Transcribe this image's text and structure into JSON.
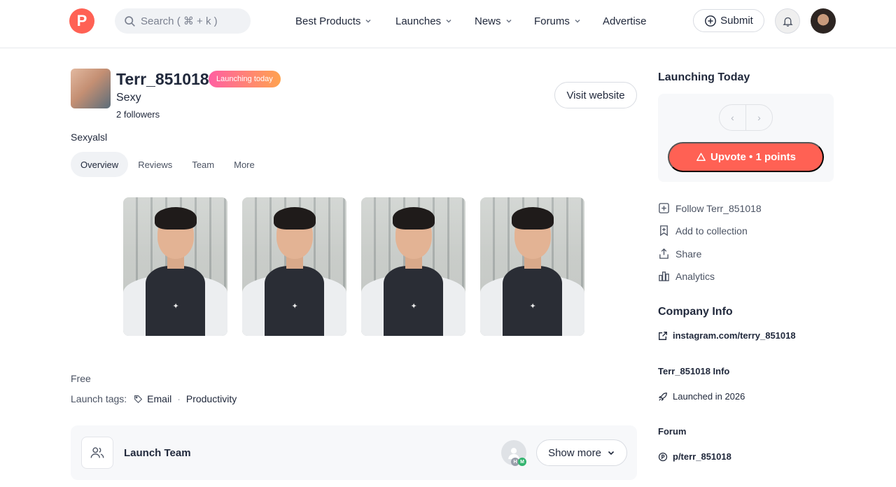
{
  "header": {
    "logo_letter": "P",
    "search_placeholder": "Search ( ⌘ + k )",
    "nav": [
      {
        "label": "Best Products",
        "has_menu": true
      },
      {
        "label": "Launches",
        "has_menu": true
      },
      {
        "label": "News",
        "has_menu": true
      },
      {
        "label": "Forums",
        "has_menu": true
      },
      {
        "label": "Advertise",
        "has_menu": false
      }
    ],
    "submit_label": "Submit"
  },
  "product": {
    "name": "Terr_851018",
    "badge": "Launching today",
    "tagline": "Sexy",
    "followers": "2 followers",
    "visit_label": "Visit website",
    "description": "Sexyalsl",
    "tabs": [
      "Overview",
      "Reviews",
      "Team",
      "More"
    ],
    "active_tab": "Overview",
    "gallery_count": 4,
    "price": "Free",
    "tags_label": "Launch tags:",
    "tags": [
      "Email",
      "Productivity"
    ]
  },
  "team": {
    "label": "Launch Team",
    "show_more_label": "Show more",
    "avatar_badges": [
      "H",
      "M"
    ]
  },
  "sidebar": {
    "launching_title": "Launching Today",
    "upvote_label": "Upvote • 1 points",
    "actions": [
      {
        "icon": "plus-square-icon",
        "label": "Follow Terr_851018"
      },
      {
        "icon": "bookmark-icon",
        "label": "Add to collection"
      },
      {
        "icon": "share-icon",
        "label": "Share"
      },
      {
        "icon": "analytics-icon",
        "label": "Analytics"
      }
    ],
    "company_title": "Company Info",
    "company_link": "instagram.com/terry_851018",
    "info_title": "Terr_851018 Info",
    "launched_text": "Launched in 2026",
    "forum_title": "Forum",
    "forum_link": "p/terr_851018"
  },
  "colors": {
    "brand": "#ff6154",
    "text": "#21293c",
    "muted": "#4b5363"
  }
}
